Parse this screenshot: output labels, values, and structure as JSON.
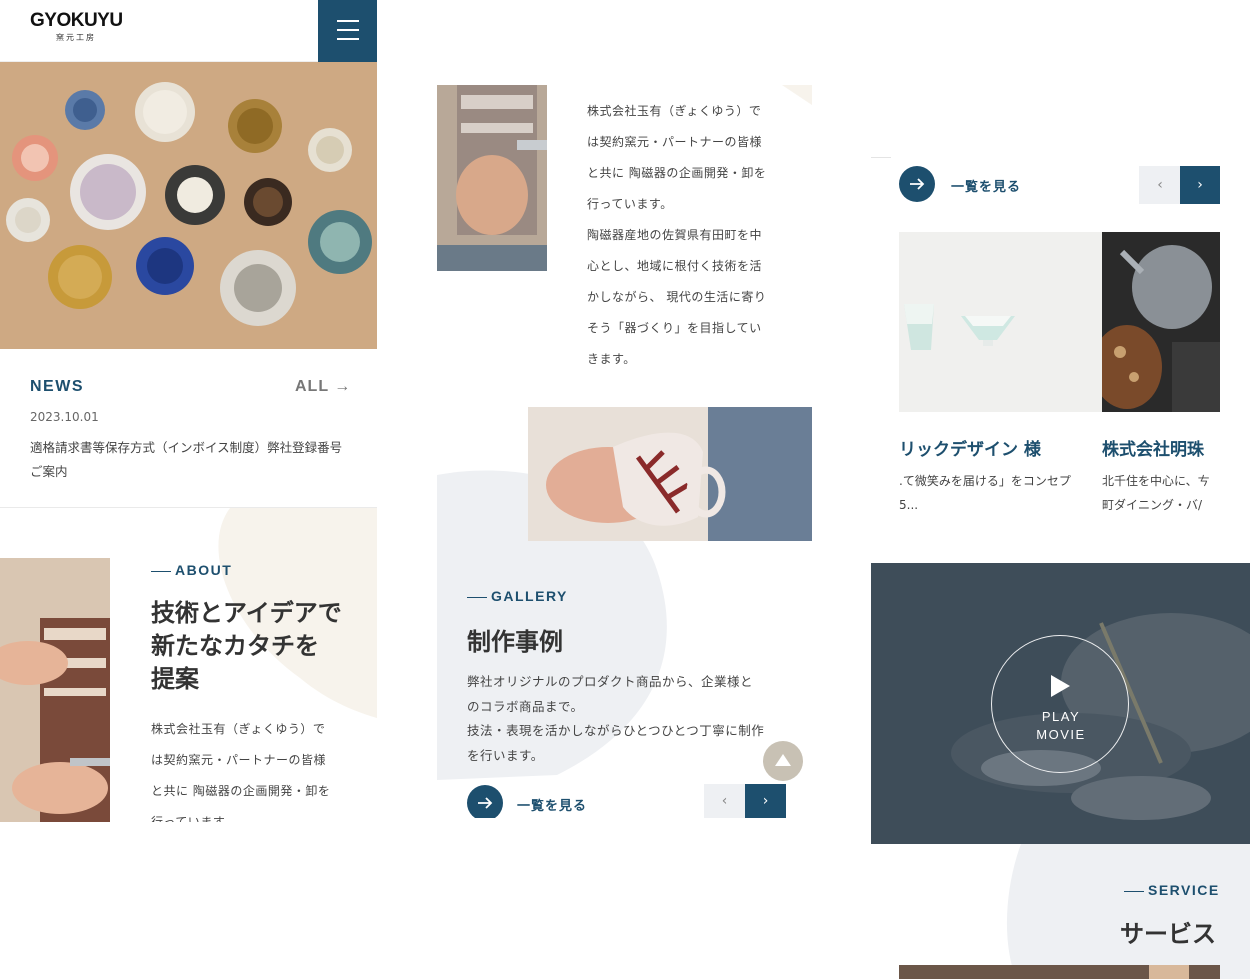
{
  "brand": {
    "logo_text": "GYOKUYU",
    "logo_sub": "窯元工房"
  },
  "news": {
    "title": "NEWS",
    "all_link": "ALL →",
    "items": [
      {
        "date": "2023.10.01",
        "text": "適格請求書等保存方式（インボイス制度）弊社登録番号　ご案内"
      }
    ]
  },
  "about": {
    "label": "ABOUT",
    "heading_lines": [
      "技術とアイデアで",
      "新たなカタチを",
      "提案"
    ],
    "body_lines": [
      "株式会社玉有（ぎょくゆう）で",
      "は契約窯元・パートナーの皆様",
      "と共に 陶磁器の企画開発・卸を",
      "行っています。"
    ]
  },
  "intro": {
    "body_lines": [
      "株式会社玉有（ぎょくゆう）で",
      "は契約窯元・パートナーの皆様",
      "と共に 陶磁器の企画開発・卸を",
      "行っています。",
      "陶磁器産地の佐賀県有田町を中",
      "心とし、地域に根付く技術を活",
      "かしながら、 現代の生活に寄り",
      "そう「器づくり」を目指してい",
      "きます。"
    ]
  },
  "gallery": {
    "label": "GALLERY",
    "heading": "制作事例",
    "body_lines": [
      "弊社オリジナルのプロダクト商品から、企業様と",
      "のコラボ商品まで。",
      "技法・表現を活かしながらひとつひとつ丁寧に制作",
      "を行います。"
    ],
    "more_label": "一覧を見る",
    "prev": "‹",
    "next": "›"
  },
  "cases": {
    "more_label": "一覧を見る",
    "prev": "‹",
    "next": "›",
    "items": [
      {
        "name": "リックデザイン 様",
        "desc_lines": [
          ".て微笑みを届ける」をコンセプ",
          "5..."
        ]
      },
      {
        "name": "株式会社明珠",
        "desc_lines": [
          "北千住を中心に、ㄘ",
          "町ダイニング・バ/"
        ]
      }
    ]
  },
  "movie": {
    "play_line1": "PLAY",
    "play_line2": "MOVIE"
  },
  "service": {
    "label": "SERVICE",
    "heading": "サービス"
  },
  "colors": {
    "brand_navy": "#1d4f6e",
    "beige": "#f7f3ec",
    "light_gray": "#eef0f3"
  }
}
